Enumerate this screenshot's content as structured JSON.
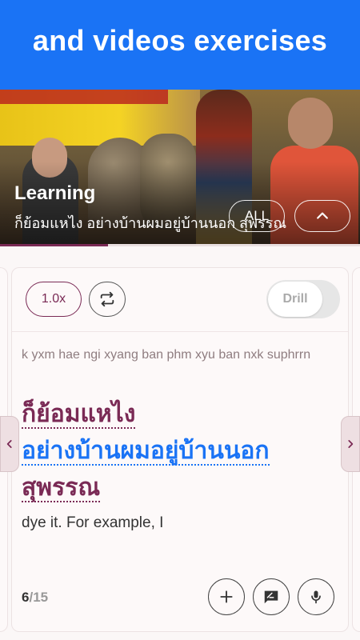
{
  "banner": {
    "title": "and videos exercises"
  },
  "video": {
    "title": "Learning",
    "subtitle": "ก็ย้อมแหไง อย่างบ้านผมอยู่บ้านนอก สุพรรณ",
    "all_label": "ALL",
    "collapse_icon": "chevron-up-icon",
    "progress": 0.3
  },
  "controls": {
    "speed_label": "1.0x",
    "loop_icon": "repeat-icon",
    "drill_label": "Drill"
  },
  "sentence": {
    "transliteration": "k yxm hae ngi xyang ban phm xyu ban nxk suphrrn",
    "thai_words": [
      "ก็ย้อมแหไง",
      "อย่างบ้านผมอยู่บ้านนอก",
      "สุพรรณ"
    ],
    "translation": "dye it. For example, I"
  },
  "counter": {
    "current": "6",
    "total": "/15"
  },
  "actions": {
    "add_icon": "plus-icon",
    "chat_icon": "feedback-icon",
    "mic_icon": "mic-icon"
  },
  "colors": {
    "accent": "#7a2a55",
    "banner": "#1a73f5",
    "highlight": "#1a73f5"
  }
}
